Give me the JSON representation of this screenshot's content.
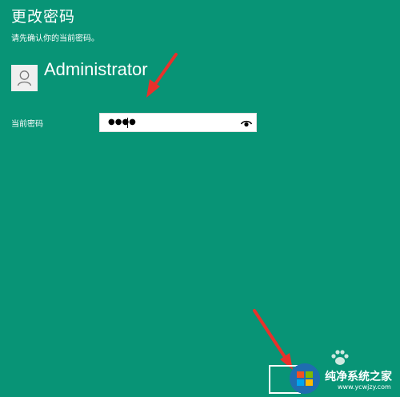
{
  "header": {
    "title": "更改密码",
    "subtitle": "请先确认你的当前密码。"
  },
  "account": {
    "username": "Administrator",
    "avatar_icon": "user-silhouette-icon"
  },
  "password": {
    "label": "当前密码",
    "masked_value": "●●●●",
    "reveal_icon": "eye-icon"
  },
  "footer": {
    "next_button_label": ""
  },
  "watermark": {
    "text": "纯净系统之家",
    "url": "www.ycwjzy.com"
  },
  "colors": {
    "background": "#089476",
    "text": "#ffffff",
    "arrow": "#e8312b"
  }
}
